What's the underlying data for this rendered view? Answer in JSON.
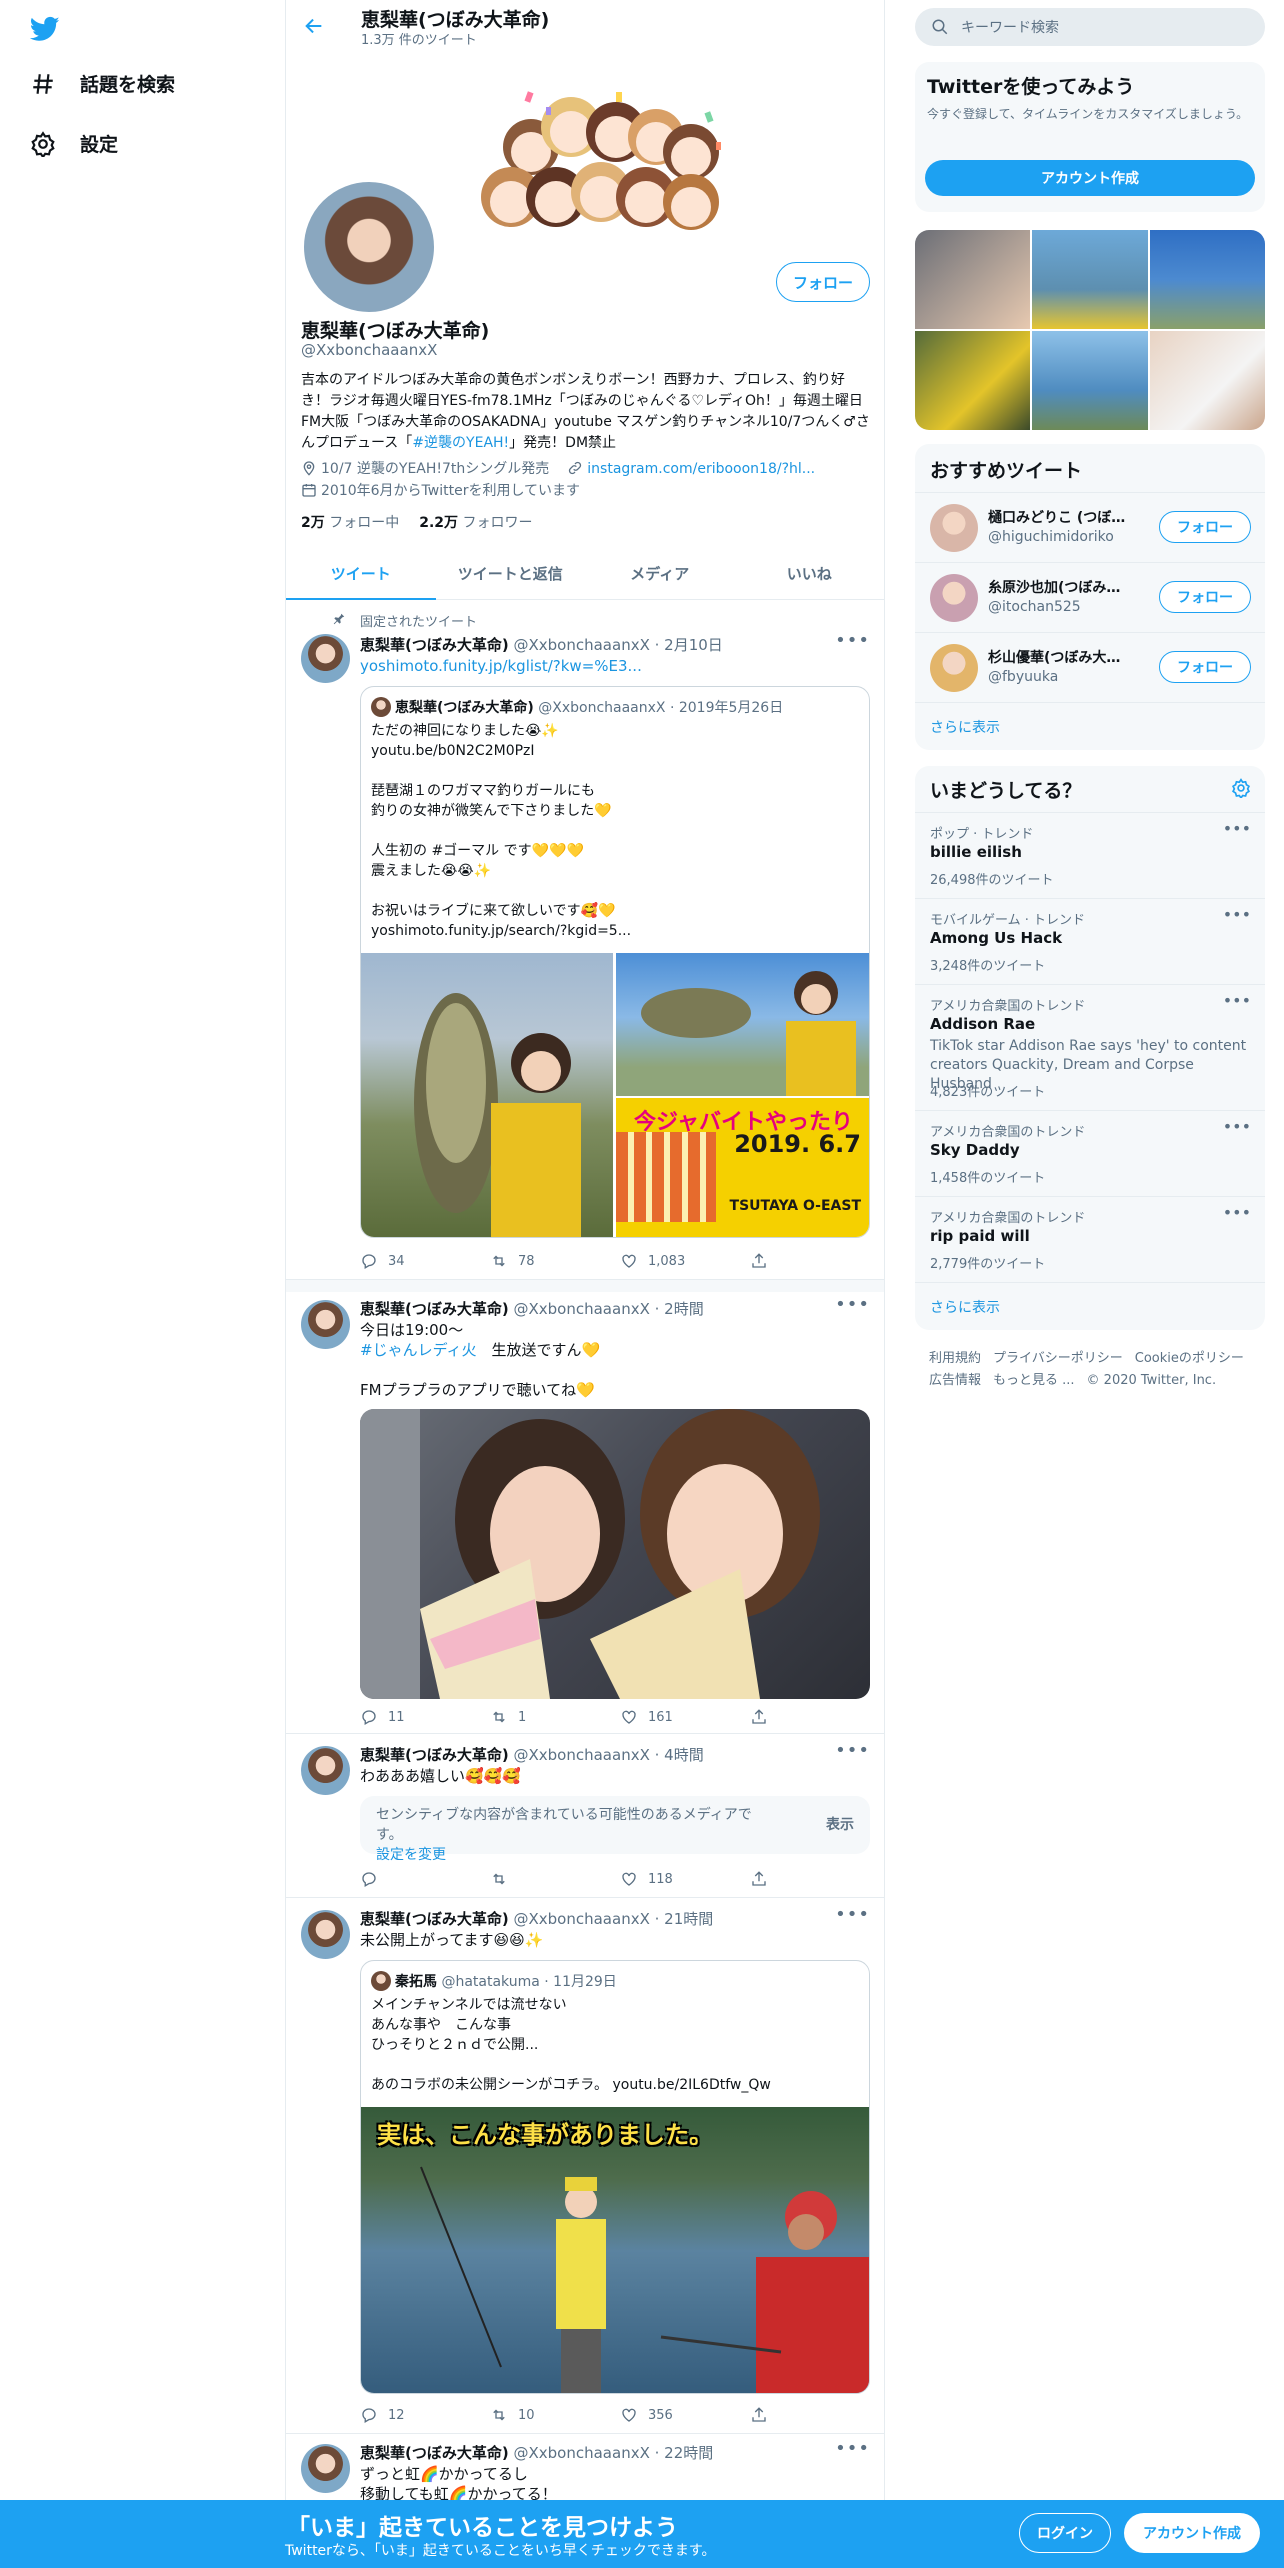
{
  "nav": {
    "explore_label": "話題を検索",
    "settings_label": "設定"
  },
  "header": {
    "title": "恵梨華(つぼみ大革命)",
    "tweet_count": "1.3万 件のツイート"
  },
  "profile": {
    "name": "恵梨華(つぼみ大革命)",
    "handle": "@XxbonchaaanxX",
    "follow_label": "フォロー",
    "bio_1": "吉本のアイドルつぼみ大革命の黄色ボンボンえりボーン！西野カナ、プロレス、釣り好き！ラジオ毎週火曜日YES-fm78.1MHz「つぼみのじゃんぐる♡レディOh！」毎週土曜日FM大阪「つぼみ大革命のOSAKADNA」youtube マスゲン釣りチャンネル10/7つんく♂さんプロデュース「",
    "bio_hashtag": "#逆襲のYEAH!",
    "bio_2": "」発売！DM禁止",
    "location": "10/7 逆襲のYEAH!7thシングル発売",
    "website": "instagram.com/eribooon18/?hl...",
    "joined": "2010年6月からTwitterを利用しています",
    "following_count": "2万",
    "following_label": "フォロー中",
    "followers_count": "2.2万",
    "followers_label": "フォロワー"
  },
  "tabs": [
    "ツイート",
    "ツイートと返信",
    "メディア",
    "いいね"
  ],
  "tweets": [
    {
      "pinned_label": "固定されたツイート",
      "name": "恵梨華(つぼみ大革命)",
      "meta": "@XxbonchaaanxX · 2月10日",
      "link": "yoshimoto.funity.jp/kglist/?kw=%E3...",
      "quote": {
        "name": "恵梨華(つぼみ大革命)",
        "meta": "@XxbonchaaanxX · 2019年5月26日",
        "text_1": "ただの神回になりました😭✨\nyoutu.be/b0N2C2M0PzI\n\n琵琶湖１のワガママ釣りガールにも\n釣りの女神が微笑んで下さりました💛\n\n人生初の #ゴーマル です💛💛💛\n震えました😭😭✨\n\nお祝いはライブに来て欲しいです🥰💛\nyoshimoto.funity.jp/search/?kgid=5..."
      },
      "poster_title": "今ジャバイトやったり",
      "poster_date": "2019. 6.7",
      "poster_venue": "TSUTAYA O-EAST",
      "replies": "34",
      "retweets": "78",
      "likes": "1,083"
    },
    {
      "name": "恵梨華(つぼみ大革命)",
      "meta": "@XxbonchaaanxX · 2時間",
      "text_1": "今日は19:00〜",
      "hashtag": "#じゃんレディ火",
      "text_2": "　生放送ですん💛",
      "text_3": "FMプラプラのアプリで聴いてね💛",
      "replies": "11",
      "retweets": "1",
      "likes": "161"
    },
    {
      "name": "恵梨華(つぼみ大革命)",
      "meta": "@XxbonchaaanxX · 4時間",
      "text": "わあああ嬉しい🥰🥰🥰",
      "sensitive_text": "センシティブな内容が含まれている可能性のあるメディアです。",
      "sensitive_link": "設定を変更",
      "show_label": "表示",
      "replies": "",
      "retweets": "",
      "likes": "118"
    },
    {
      "name": "恵梨華(つぼみ大革命)",
      "meta": "@XxbonchaaanxX · 21時間",
      "text": "未公開上がってます😆😆✨",
      "quote": {
        "name": "秦拓馬",
        "meta": "@hatatakuma · 11月29日",
        "text": "メインチャンネルでは流せない\nあんな事や　こんな事\nひっそりと２ｎｄで公開...\n\nあのコラボの未公開シーンがコチラ。 youtu.be/2IL6Dtfw_Qw"
      },
      "thumb_text": "実は、こんな事がありました。",
      "replies": "12",
      "retweets": "10",
      "likes": "356"
    },
    {
      "name": "恵梨華(つぼみ大革命)",
      "meta": "@XxbonchaaanxX · 22時間",
      "text": "ずっと虹🌈かかってるし\n移動しても虹🌈かかってる！"
    }
  ],
  "sidebar": {
    "search_placeholder": "キーワード検索",
    "signup_card": {
      "title": "Twitterを使ってみよう",
      "sub": "今すぐ登録して、タイムラインをカスタマイズしましょう。",
      "button": "アカウント作成"
    },
    "recommend": {
      "title": "おすすめツイート",
      "users": [
        {
          "name": "樋口みどりこ (つぼみ…",
          "handle": "@higuchimidoriko",
          "follow": "フォロー",
          "color": "#d9b6a8"
        },
        {
          "name": "糸原沙也加(つぼみ大…",
          "handle": "@itochan525",
          "follow": "フォロー",
          "color": "#c9a0b0"
        },
        {
          "name": "杉山優華(つぼみ大革…",
          "handle": "@fbyuuka",
          "follow": "フォロー",
          "color": "#e3b56a"
        }
      ],
      "more": "さらに表示"
    },
    "trends": {
      "title": "いまどうしてる？",
      "items": [
        {
          "cat": "ポップ · トレンド",
          "name": "billie eilish",
          "desc": "",
          "count": "26,498件のツイート"
        },
        {
          "cat": "モバイルゲーム · トレンド",
          "name": "Among Us Hack",
          "desc": "",
          "count": "3,248件のツイート"
        },
        {
          "cat": "アメリカ合衆国のトレンド",
          "name": "Addison Rae",
          "desc": "TikTok star Addison Rae says 'hey' to content creators Quackity, Dream and Corpse Husband",
          "count": "4,823件のツイート"
        },
        {
          "cat": "アメリカ合衆国のトレンド",
          "name": "Sky Daddy",
          "desc": "",
          "count": "1,458件のツイート"
        },
        {
          "cat": "アメリカ合衆国のトレンド",
          "name": "rip paid will",
          "desc": "",
          "count": "2,779件のツイート"
        }
      ],
      "more": "さらに表示"
    },
    "footer": {
      "terms": "利用規約",
      "privacy": "プライバシーポリシー",
      "cookie": "Cookieのポリシー",
      "ads": "広告情報",
      "more": "もっと見る ...",
      "copyright": "© 2020 Twitter, Inc."
    }
  },
  "bottom_bar": {
    "title": "「いま」起きていることを見つけよう",
    "sub": "Twitterなら、「いま」起きていることをいち早くチェックできます。",
    "login": "ログイン",
    "signup": "アカウント作成"
  },
  "colors": {
    "accent": "#1da1f2",
    "link": "#1b95e0",
    "muted": "#5b7083"
  }
}
